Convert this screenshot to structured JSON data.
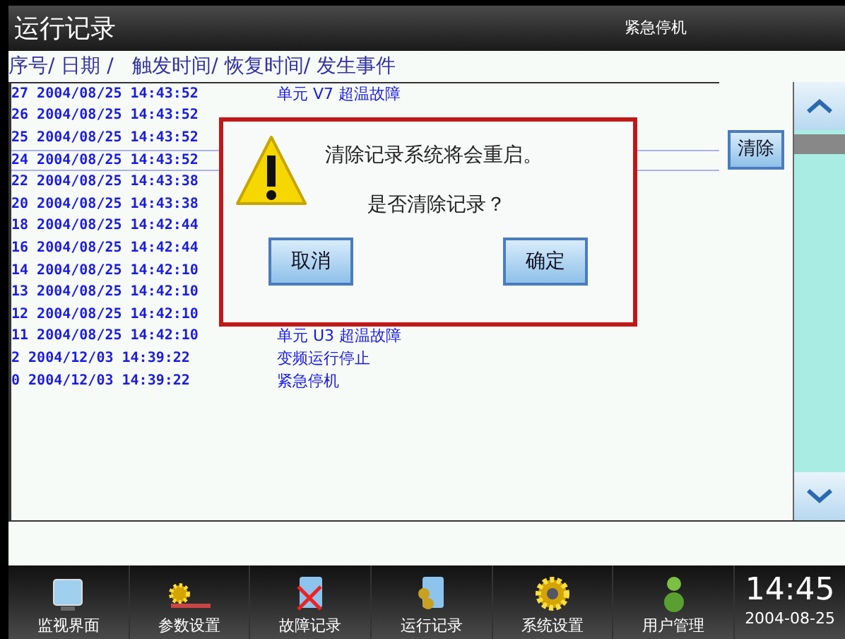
{
  "window": {
    "title": "运行记录",
    "status": "紧急停机"
  },
  "table": {
    "header": "序号/ 日期 /   触发时间/ 恢复时间/ 发生事件",
    "rows": [
      {
        "record": "27 2004/08/25 14:43:52",
        "event": "单元 V7 超温故障",
        "selected": false
      },
      {
        "record": "26 2004/08/25 14:43:52",
        "selected": false
      },
      {
        "record": "25 2004/08/25 14:43:52",
        "selected": false
      },
      {
        "record": "24 2004/08/25 14:43:52",
        "selected": true
      },
      {
        "record": "22 2004/08/25 14:43:38",
        "selected": false
      },
      {
        "record": "20 2004/08/25 14:43:38",
        "selected": false
      },
      {
        "record": "18 2004/08/25 14:42:44",
        "selected": false
      },
      {
        "record": "16 2004/08/25 14:42:44",
        "selected": false
      },
      {
        "record": "14 2004/08/25 14:42:10",
        "selected": false
      },
      {
        "record": "13 2004/08/25 14:42:10",
        "selected": false
      },
      {
        "record": "12 2004/08/25 14:42:10",
        "selected": false
      },
      {
        "record": "11 2004/08/25 14:42:10",
        "event": "单元 U3 超温故障",
        "selected": false
      },
      {
        "record": "2 2004/12/03 14:39:22",
        "event": "变频运行停止",
        "selected": false
      },
      {
        "record": "0 2004/12/03 14:39:22",
        "event": "紧急停机",
        "selected": false
      }
    ]
  },
  "clear_button": "清除",
  "dialog": {
    "message": "清除记录系统将会重启。",
    "question": "是否清除记录？",
    "buttons": [
      "取消",
      "确定"
    ]
  },
  "taskbar": {
    "items": [
      {
        "label": "监视界面",
        "kind": "monitor"
      },
      {
        "label": "参数设置",
        "kind": "params"
      },
      {
        "label": "故障记录",
        "kind": "fault"
      },
      {
        "label": "运行记录",
        "kind": "run"
      },
      {
        "label": "系统设置",
        "kind": "system"
      },
      {
        "label": "用户管理",
        "kind": "user"
      }
    ],
    "time": "14:45",
    "date": "2004-08-25"
  }
}
